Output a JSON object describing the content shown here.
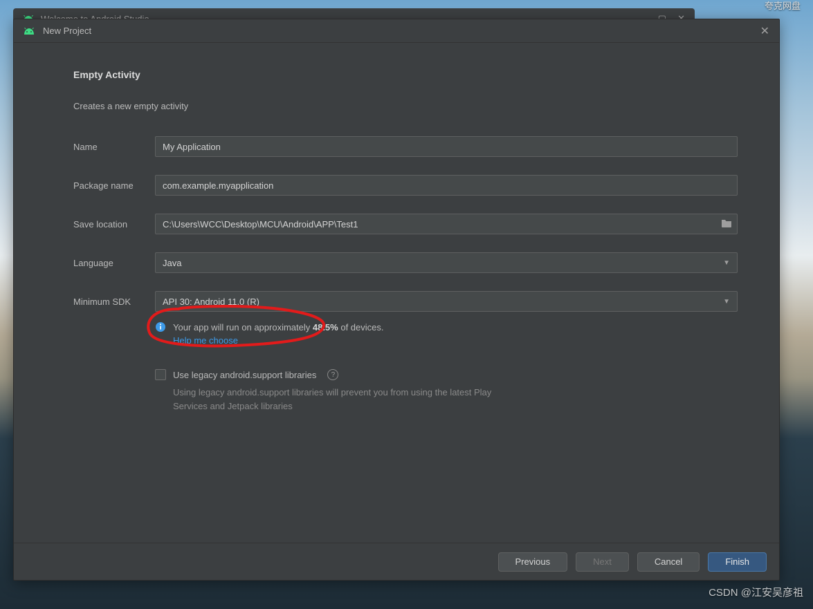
{
  "taskbar": {
    "item_kuake": "夸克网盘"
  },
  "welcome_window": {
    "title": "Welcome to Android Studio"
  },
  "dialog": {
    "title": "New Project",
    "heading": "Empty Activity",
    "description": "Creates a new empty activity",
    "labels": {
      "name": "Name",
      "package": "Package name",
      "save": "Save location",
      "language": "Language",
      "minsdk": "Minimum SDK"
    },
    "values": {
      "name": "My Application",
      "package": "com.example.myapplication",
      "save": "C:\\Users\\WCC\\Desktop\\MCU\\Android\\APP\\Test1",
      "language": "Java",
      "minsdk": "API 30: Android 11.0 (R)"
    },
    "info_pre": "Your app will run on approximately ",
    "info_pct": "48.5%",
    "info_post": " of devices.",
    "help_link": "Help me choose",
    "legacy_check": "Use legacy android.support libraries",
    "legacy_text": "Using legacy android.support libraries will prevent you from using the latest Play Services and Jetpack libraries",
    "buttons": {
      "previous": "Previous",
      "next": "Next",
      "cancel": "Cancel",
      "finish": "Finish"
    }
  },
  "watermark": "CSDN @江安吴彦祖"
}
